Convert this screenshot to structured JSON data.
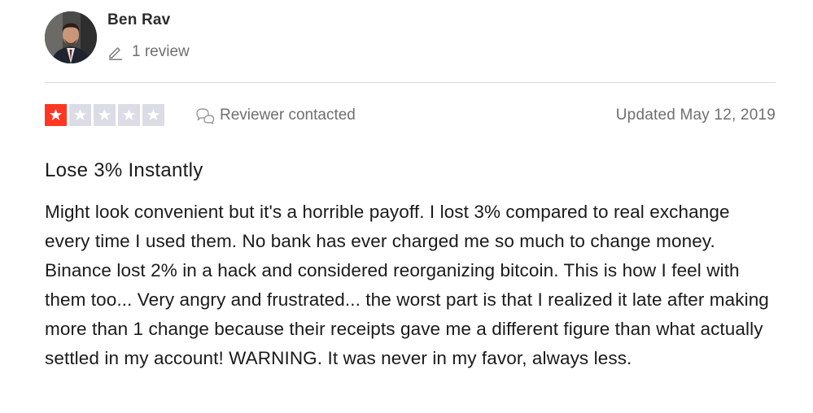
{
  "reviewer": {
    "name": "Ben Rav",
    "review_count": "1 review",
    "avatar_icon": "person-avatar"
  },
  "rating": {
    "value": 1,
    "max": 5,
    "filled_color": "#ff3722",
    "empty_color": "#dcdce6"
  },
  "status": {
    "contacted_label": "Reviewer contacted",
    "updated_label": "Updated May 12, 2019"
  },
  "review": {
    "title": "Lose 3% Instantly",
    "body": "Might look convenient but it's a horrible payoff. I lost 3% compared to real exchange every time I used them. No bank has ever charged me so much to change money. Binance lost 2% in a hack and considered reorganizing bitcoin. This is how I feel with them too... Very angry and frustrated... the worst part is that I realized it late after making more than 1 change because their receipts gave me a different figure than what actually settled in my account! WARNING. It was never in my favor, always less."
  }
}
